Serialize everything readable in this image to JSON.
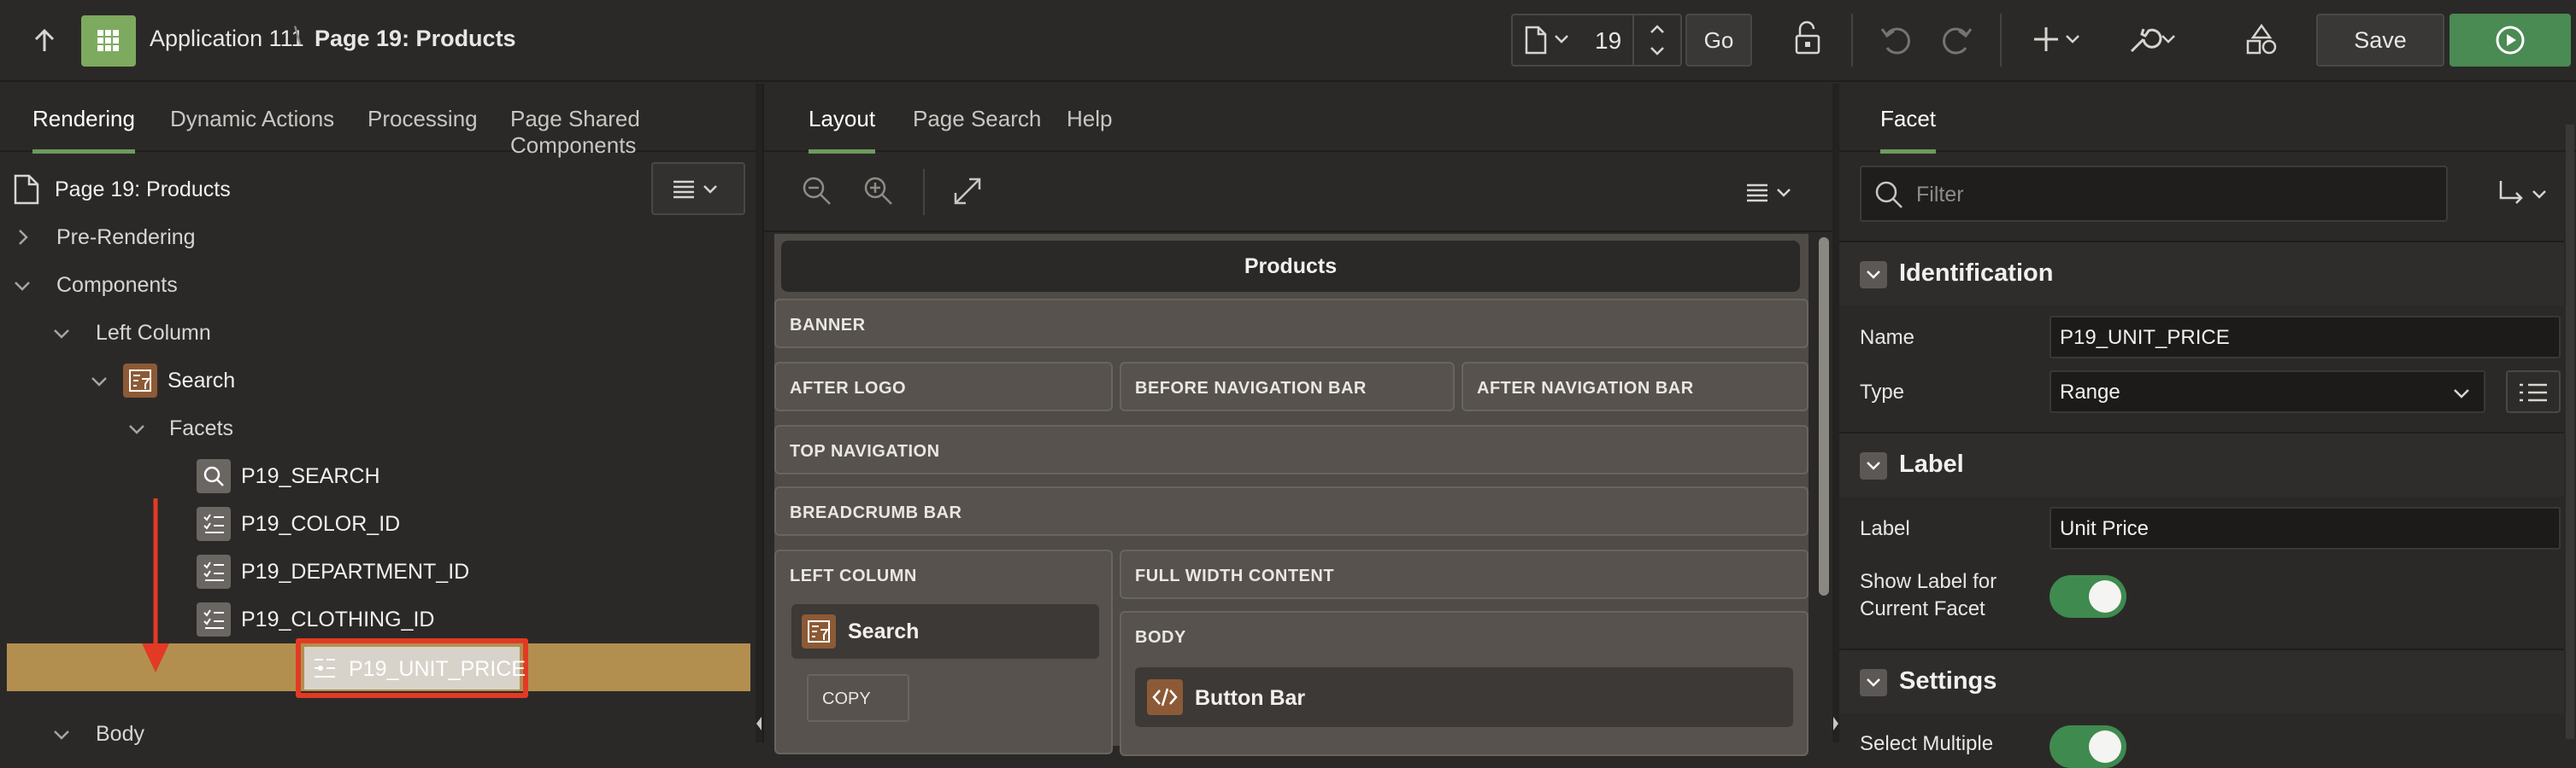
{
  "header": {
    "app_name": "Application 111",
    "separator": "\\",
    "page_title": "Page 19: Products",
    "page_number": "19",
    "go_label": "Go",
    "save_label": "Save"
  },
  "left_pane": {
    "tabs": [
      "Rendering",
      "Dynamic Actions",
      "Processing",
      "Page Shared Components"
    ],
    "tree": {
      "root": "Page 19: Products",
      "pre_rendering": "Pre-Rendering",
      "components": "Components",
      "left_column": "Left Column",
      "search": "Search",
      "facets": "Facets",
      "items": [
        "P19_SEARCH",
        "P19_COLOR_ID",
        "P19_DEPARTMENT_ID",
        "P19_CLOTHING_ID",
        "P19_UNIT_PRICE"
      ],
      "body": "Body"
    }
  },
  "middle_pane": {
    "tabs": [
      "Layout",
      "Page Search",
      "Help"
    ],
    "page_name": "Products",
    "regions": {
      "banner": "BANNER",
      "after_logo": "AFTER LOGO",
      "before_nav": "BEFORE NAVIGATION BAR",
      "after_nav": "AFTER NAVIGATION BAR",
      "top_nav": "TOP NAVIGATION",
      "breadcrumb": "BREADCRUMB BAR",
      "left_column": "LEFT COLUMN",
      "full_width": "FULL WIDTH CONTENT",
      "body": "BODY"
    },
    "components": {
      "search": "Search",
      "copy": "COPY",
      "button_bar": "Button Bar"
    }
  },
  "right_pane": {
    "tab": "Facet",
    "filter_placeholder": "Filter",
    "sections": {
      "identification": "Identification",
      "label": "Label",
      "settings": "Settings"
    },
    "props": {
      "name_label": "Name",
      "name_value": "P19_UNIT_PRICE",
      "type_label": "Type",
      "type_value": "Range",
      "label_label": "Label",
      "label_value": "Unit Price",
      "show_label_label": "Show Label for Current Facet",
      "show_label_value": true,
      "select_multiple_label": "Select Multiple"
    }
  },
  "colors": {
    "accent_green": "#4a8a53",
    "selection": "#b38f4f",
    "highlight_red": "#e23a24",
    "annotation_arrow": "#e23a24"
  }
}
